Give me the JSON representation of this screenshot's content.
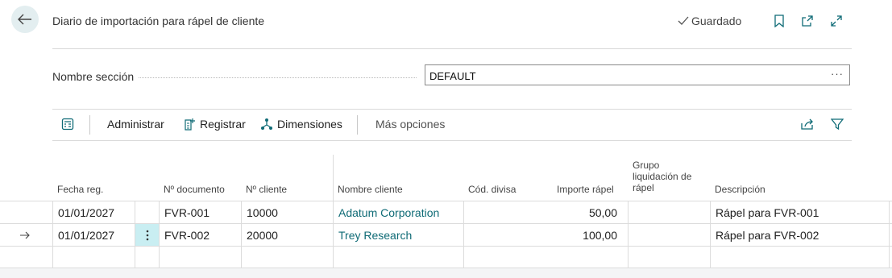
{
  "header": {
    "title": "Diario de importación para rápel de cliente",
    "saved_label": "Guardado"
  },
  "section": {
    "label": "Nombre sección",
    "value": "DEFAULT",
    "more": "···"
  },
  "toolbar": {
    "manage": "Administrar",
    "post": "Registrar",
    "dimensions": "Dimensiones",
    "more_options": "Más opciones"
  },
  "columns": {
    "date": "Fecha reg.",
    "doc_no": "Nº documento",
    "customer_no": "Nº cliente",
    "customer_name": "Nombre cliente",
    "currency": "Cód. divisa",
    "amount": "Importe rápel",
    "group": "Grupo liquidación de rápel",
    "description": "Descripción"
  },
  "rows": [
    {
      "date": "01/01/2027",
      "doc_no": "FVR-001",
      "customer_no": "10000",
      "customer_name": "Adatum Corporation",
      "currency": "",
      "amount": "50,00",
      "group": "",
      "description": "Rápel para FVR-001"
    },
    {
      "date": "01/01/2027",
      "doc_no": "FVR-002",
      "customer_no": "20000",
      "customer_name": "Trey Research",
      "currency": "",
      "amount": "100,00",
      "group": "",
      "description": "Rápel para FVR-002"
    }
  ],
  "colors": {
    "accent": "#0f6b76",
    "selected_cell": "#c9eef2"
  }
}
